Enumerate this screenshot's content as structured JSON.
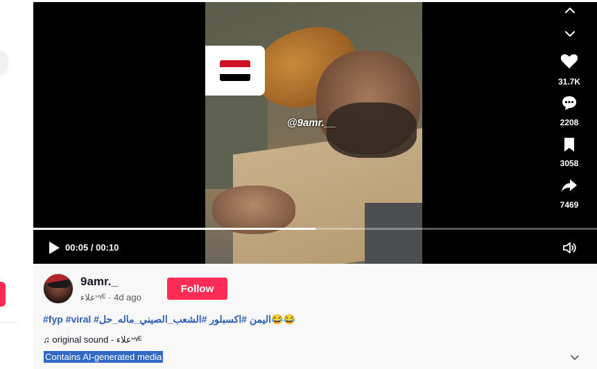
{
  "video": {
    "watermark": "@9amr.__",
    "flag": {
      "colors": [
        "#ce1126",
        "#ffffff",
        "#000000"
      ]
    },
    "time": "00:05 / 00:10",
    "progress_fraction": 0.5
  },
  "actions": {
    "likes": "31.7K",
    "comments": "2208",
    "saves": "3058",
    "shares": "7469"
  },
  "author": {
    "username": "9amr._",
    "subline": "علاء𐞖ᵞᴱ · 4d ago"
  },
  "follow_label": "Follow",
  "caption": {
    "hashtags": "#fyp #viral #اليمن #اكسبلور #الشعب_الصيني_ماله_حل",
    "emoji": "😂😂"
  },
  "sound": {
    "icon": "music-note-icon",
    "text": "♫ original sound - علاء𐞖ᵞᴱ"
  },
  "ai_label": "Contains AI-generated media",
  "colors": {
    "accent": "#fe2c55",
    "hashtag": "#2b5db9",
    "selection": "#3169c4"
  }
}
